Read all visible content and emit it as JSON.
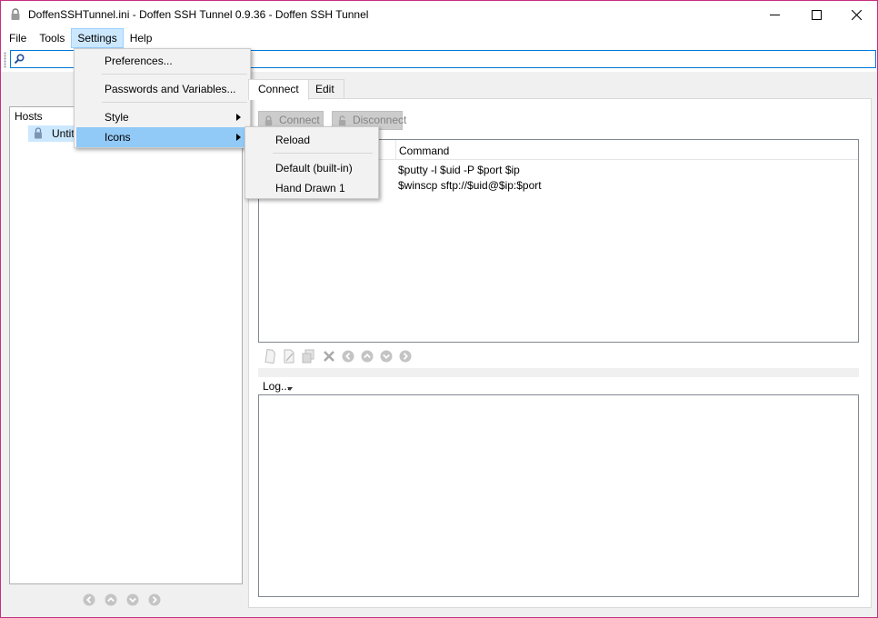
{
  "window": {
    "title": "DoffenSSHTunnel.ini - Doffen SSH Tunnel 0.9.36  - Doffen SSH Tunnel",
    "accent_border": "#c62f80"
  },
  "menubar": {
    "items": [
      "File",
      "Tools",
      "Settings",
      "Help"
    ],
    "active": "Settings"
  },
  "search": {
    "value": "",
    "placeholder": ""
  },
  "hosts": {
    "header": "Hosts",
    "items": [
      {
        "label": "Untitled",
        "icon": "lock-icon"
      }
    ]
  },
  "tabs": {
    "items": [
      "Connect",
      "Edit"
    ],
    "selected": "Connect"
  },
  "connect": {
    "connect_label": "Connect",
    "disconnect_label": "Disconnect"
  },
  "commands": {
    "column_header": "Command",
    "rows": [
      "$putty -l $uid -P $port $ip",
      "$winscp sftp://$uid@$ip:$port"
    ]
  },
  "log": {
    "label": "Log..."
  },
  "settings_menu": {
    "items": [
      {
        "label": "Preferences...",
        "submenu": false
      },
      {
        "label": "Passwords and Variables...",
        "submenu": false
      },
      {
        "label": "Style",
        "submenu": true
      },
      {
        "label": "Icons",
        "submenu": true,
        "highlighted": true
      }
    ]
  },
  "icons_submenu": {
    "items": [
      "Reload",
      "Default (built-in)",
      "Hand Drawn 1"
    ]
  },
  "colors": {
    "menu_highlight": "#91c9f7",
    "active_menu_bg": "#cce8ff",
    "selection": "#cce8ff",
    "focus_border": "#0078d7"
  }
}
